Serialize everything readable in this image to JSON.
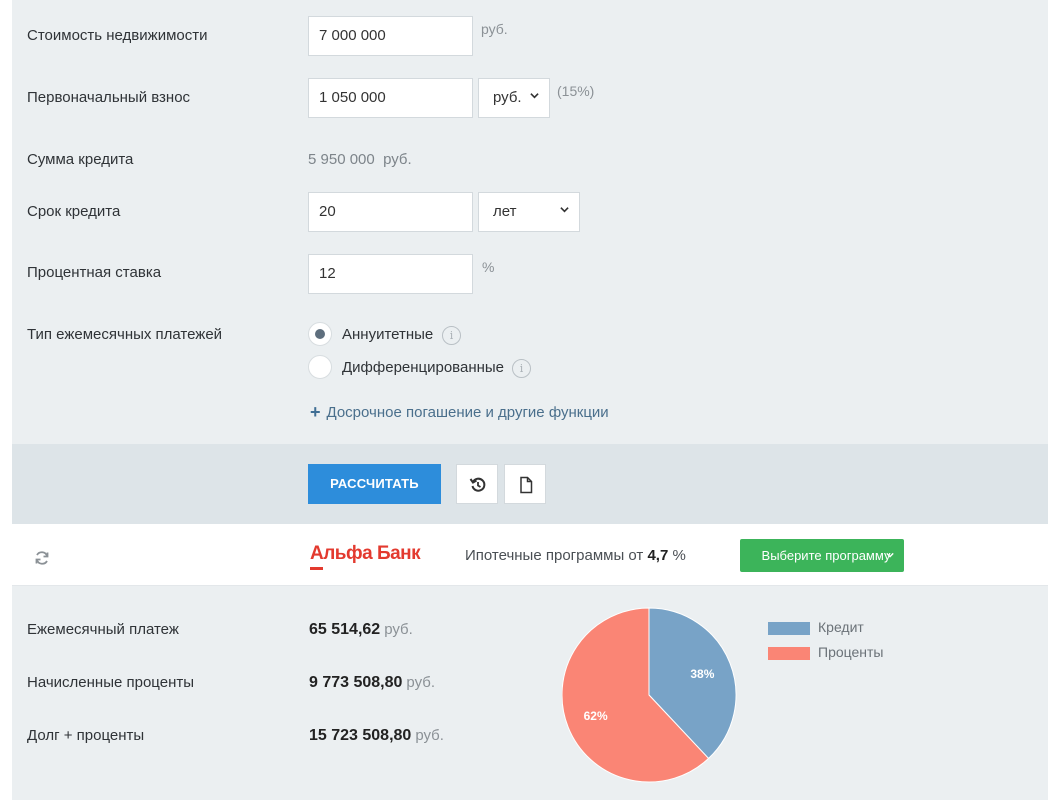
{
  "form": {
    "property_cost": {
      "label": "Стоимость недвижимости",
      "value": "7 000 000",
      "unit": "руб."
    },
    "down_payment": {
      "label": "Первоначальный взнос",
      "value": "1 050 000",
      "unit_select": "руб.",
      "percent_note": "(15%)"
    },
    "loan_amount": {
      "label": "Сумма кредита",
      "value": "5 950 000",
      "unit": "руб."
    },
    "loan_term": {
      "label": "Срок кредита",
      "value": "20",
      "unit_select": "лет"
    },
    "interest_rate": {
      "label": "Процентная ставка",
      "value": "12",
      "unit": "%"
    },
    "payment_type": {
      "label": "Тип ежемесячных платежей",
      "options": [
        {
          "label": "Аннуитетные",
          "selected": true
        },
        {
          "label": "Дифференцированные",
          "selected": false
        }
      ]
    },
    "more_link": "Досрочное погашение и другие функции"
  },
  "actions": {
    "calculate_label": "РАССЧИТАТЬ"
  },
  "bank": {
    "name": "Альфа Банк",
    "promo_prefix": "Ипотечные программы от",
    "promo_rate": "4,7",
    "promo_suffix": "%",
    "choose_program_label": "Выберите программу"
  },
  "results": {
    "monthly_payment": {
      "label": "Ежемесячный платеж",
      "value": "65 514,62",
      "unit": "руб."
    },
    "accrued_interest": {
      "label": "Начисленные проценты",
      "value": "9 773 508,80",
      "unit": "руб."
    },
    "total": {
      "label": "Долг + проценты",
      "value": "15 723 508,80",
      "unit": "руб."
    }
  },
  "chart_data": {
    "type": "pie",
    "slices": [
      {
        "name": "Кредит",
        "value": 38,
        "label": "38%",
        "color": "#78a3c7"
      },
      {
        "name": "Проценты",
        "value": 62,
        "label": "62%",
        "color": "#fa8575"
      }
    ],
    "legend_position": "right"
  },
  "colors": {
    "accent_blue": "#2d8ddb",
    "accent_green": "#3cb45a",
    "brand_red": "#e33a2f"
  }
}
